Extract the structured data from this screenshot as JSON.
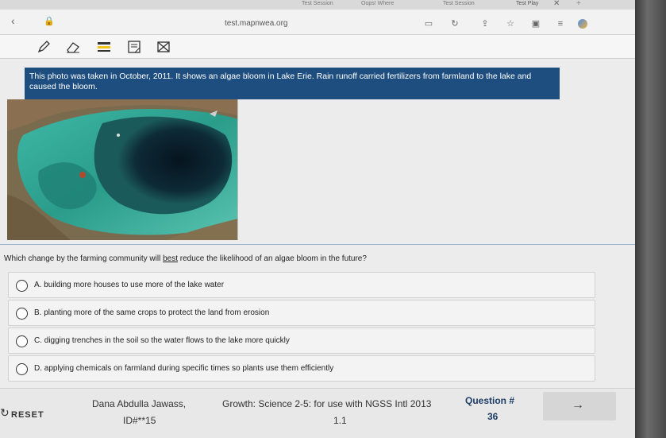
{
  "browser": {
    "tabs": [
      "Test Session",
      "Oops! Where",
      "Test Session",
      "Test Play"
    ],
    "url": "test.mapnwea.org"
  },
  "passage": {
    "text": "This photo was taken in October, 2011. It shows an algae bloom in Lake Erie. Rain runoff carried fertilizers from farmland to the lake and caused the bloom."
  },
  "question": {
    "prefix": "Which change by the farming community will ",
    "emphasis": "best",
    "suffix": " reduce the likelihood of an algae bloom in the future?"
  },
  "choices": [
    "A.   building more houses to use more of the lake water",
    "B.   planting more of the same crops to protect the land from erosion",
    "C.   digging trenches in the soil so the water flows to the lake more quickly",
    "D.   applying chemicals on farmland during specific times so plants use them efficiently"
  ],
  "footer": {
    "reset_label": "RESET",
    "student_name": "Dana Abdulla Jawass,",
    "student_id": "ID#**15",
    "test_name": "Growth: Science 2-5: for use with NGSS Intl 2013",
    "version": "1.1",
    "question_label": "Question #",
    "question_number": "36",
    "next_label": "→"
  }
}
